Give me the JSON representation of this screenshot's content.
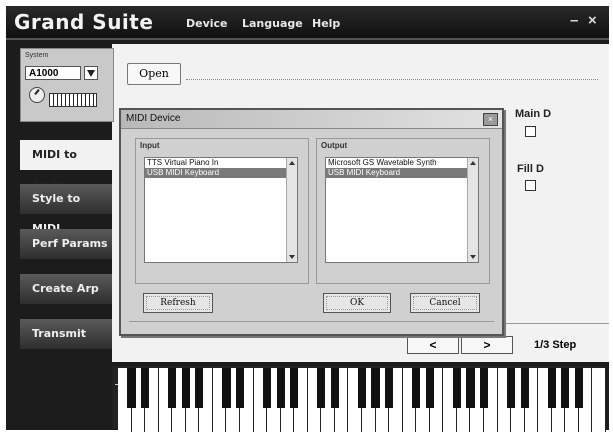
{
  "app": {
    "title": "Grand Suite",
    "menu": [
      "Device",
      "Language",
      "Help"
    ],
    "minimize": "–",
    "close": "×"
  },
  "system": {
    "label": "System",
    "selected": "A1000"
  },
  "sidebar": {
    "items": [
      {
        "label": "MIDI to Style",
        "active": true
      },
      {
        "label": "Style to MIDI",
        "active": false
      },
      {
        "label": "Perf Params",
        "active": false
      },
      {
        "label": "Create Arp",
        "active": false
      },
      {
        "label": "Transmit",
        "active": false
      }
    ]
  },
  "main": {
    "open_label": "Open",
    "main_d_label": "Main D",
    "fill_d_label": "Fill D",
    "prev_label": "<",
    "next_label": ">",
    "step_label": "1/3 Step"
  },
  "dialog": {
    "title": "MIDI Device",
    "close_label": "×",
    "input": {
      "label": "Input",
      "items": [
        "TTS Virtual Piano In",
        "USB MIDI Keyboard"
      ],
      "selected_index": 1
    },
    "output": {
      "label": "Output",
      "items": [
        "Microsoft GS Wavetable Synth",
        "USB MIDI Keyboard"
      ],
      "selected_index": 1
    },
    "refresh_label": "Refresh",
    "ok_label": "OK",
    "cancel_label": "Cancel"
  },
  "icons": {
    "system_dropdown": "chevron-down-icon",
    "system_knob": "knob-icon",
    "system_keyboard": "keyboard-icon"
  }
}
